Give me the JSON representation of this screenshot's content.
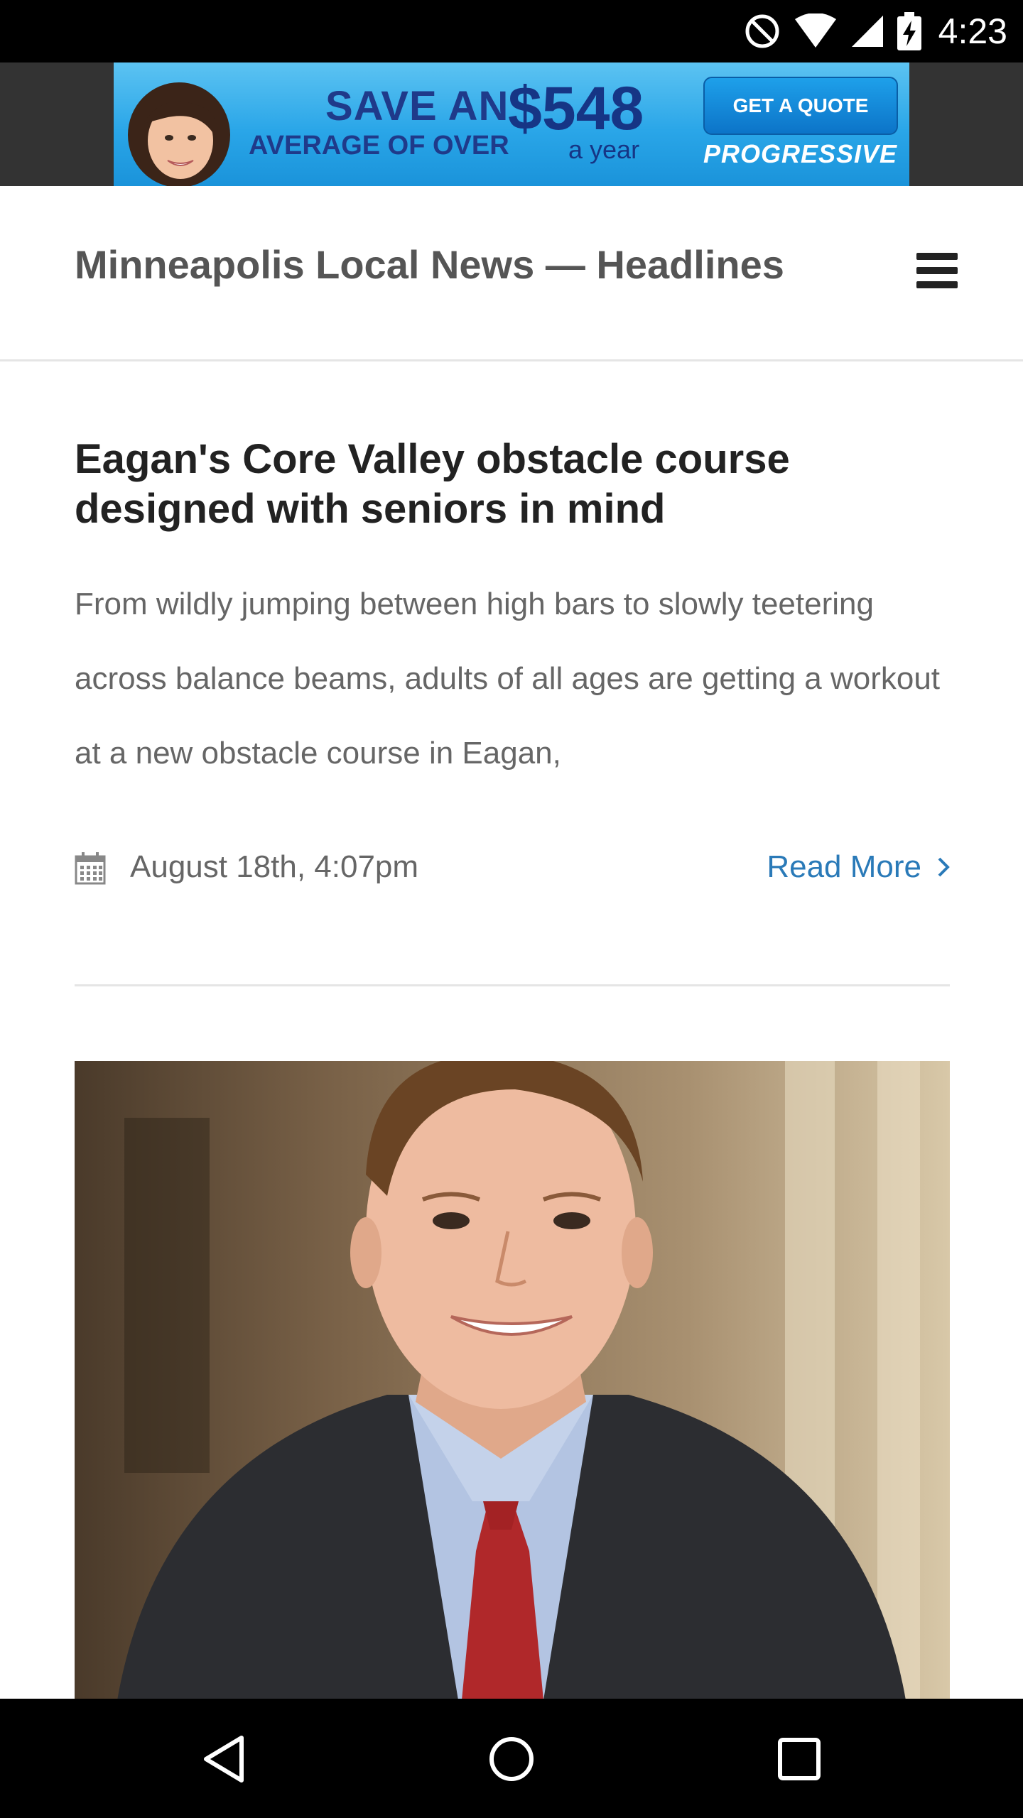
{
  "status_bar": {
    "time": "4:23",
    "icons": [
      "do-not-disturb-icon",
      "wifi-icon",
      "signal-icon",
      "battery-charging-icon"
    ]
  },
  "ad": {
    "headline_top": "SAVE AN",
    "headline_bottom": "AVERAGE OF OVER",
    "amount": "$548",
    "period": "a year",
    "cta_label": "GET A QUOTE",
    "brand": "PROGRESSIVE"
  },
  "header": {
    "site_title": "Minneapolis Local News — Headlines",
    "menu_icon": "hamburger-menu-icon"
  },
  "articles": [
    {
      "title": "Eagan's Core Valley obstacle course designed with seniors in mind",
      "excerpt": "From wildly jumping between high bars to slowly teetering across balance beams, adults of all ages are getting a workout at a new obstacle course in Eagan,",
      "date": "August 18th, 4:07pm",
      "read_more_label": "Read More"
    }
  ],
  "nav_bar": {
    "buttons": [
      "back-icon",
      "home-icon",
      "recents-icon"
    ]
  },
  "colors": {
    "link": "#2a7ab8",
    "title": "#222222",
    "body_text": "#666666",
    "site_title": "#555555"
  }
}
